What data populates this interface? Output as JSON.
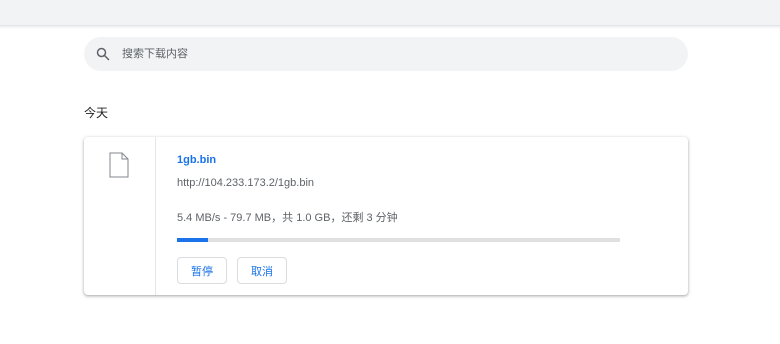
{
  "search": {
    "placeholder": "搜索下载内容",
    "value": ""
  },
  "section": {
    "title": "今天"
  },
  "download": {
    "file_name": "1gb.bin",
    "url": "http://104.233.173.2/1gb.bin",
    "status": "5.4 MB/s - 79.7 MB，共 1.0 GB，还剩 3 分钟",
    "progress_fraction": 0.07,
    "pause_label": "暂停",
    "cancel_label": "取消"
  },
  "colors": {
    "accent": "#1a73e8",
    "track": "#e0e0e0",
    "search_bg": "#f1f3f4"
  },
  "icons": {
    "search": "search-icon",
    "file": "file-icon"
  }
}
